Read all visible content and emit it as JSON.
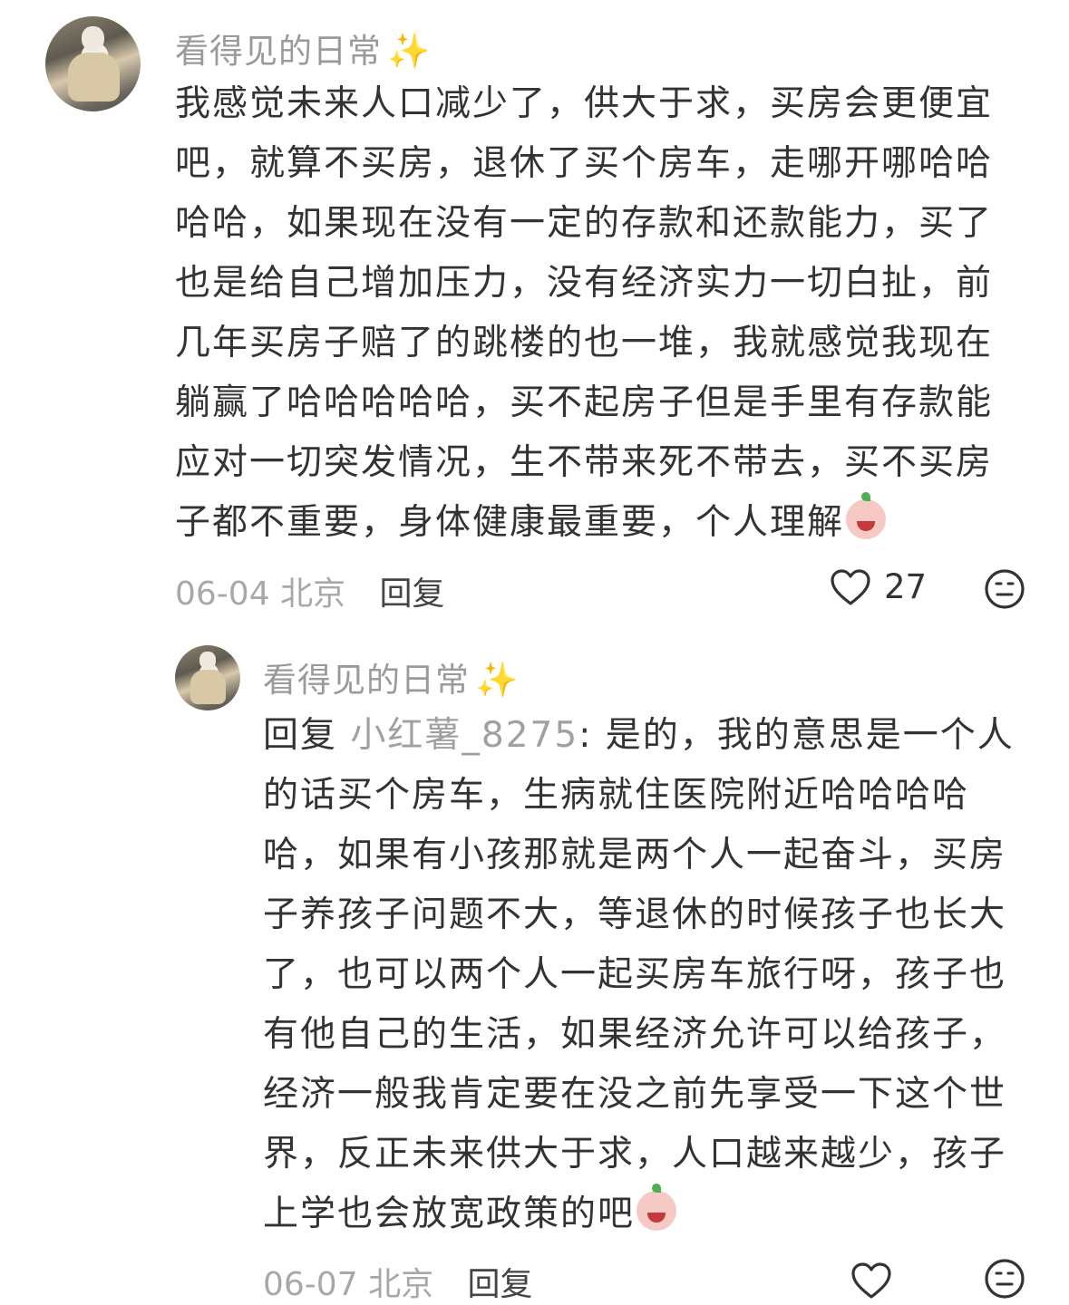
{
  "comment": {
    "username": "看得见的日常",
    "username_emoji": "✨",
    "text": "我感觉未来人口减少了，供大于求，买房会更便宜吧，就算不买房，退休了买个房车，走哪开哪哈哈哈哈，如果现在没有一定的存款和还款能力，买了也是给自己增加压力，没有经济实力一切白扯，前几年买房子赔了的跳楼的也一堆，我就感觉我现在躺赢了哈哈哈哈哈，买不起房子但是手里有存款能应对一切突发情况，生不带来死不带去，买不买房子都不重要，身体健康最重要，个人理解",
    "date": "06-04",
    "location": "北京",
    "reply_label": "回复",
    "like_count": "27",
    "icons": [
      "heart-icon",
      "dislike-face-icon"
    ]
  },
  "reply": {
    "username": "看得见的日常",
    "username_emoji": "✨",
    "reply_prefix": "回复",
    "reply_to": "小红薯_8275",
    "text": ": 是的，我的意思是一个人的话买个房车，生病就住医院附近哈哈哈哈哈，如果有小孩那就是两个人一起奋斗，买房子养孩子问题不大，等退休的时候孩子也长大了，也可以两个人一起买房车旅行呀，孩子也有他自己的生活，如果经济允许可以给孩子，经济一般我肯定要在没之前先享受一下这个世界，反正未来供大于求，人口越来越少，孩子上学也会放宽政策的吧",
    "date": "06-07",
    "location": "北京",
    "reply_label": "回复",
    "icons": [
      "heart-icon",
      "dislike-face-icon"
    ]
  }
}
